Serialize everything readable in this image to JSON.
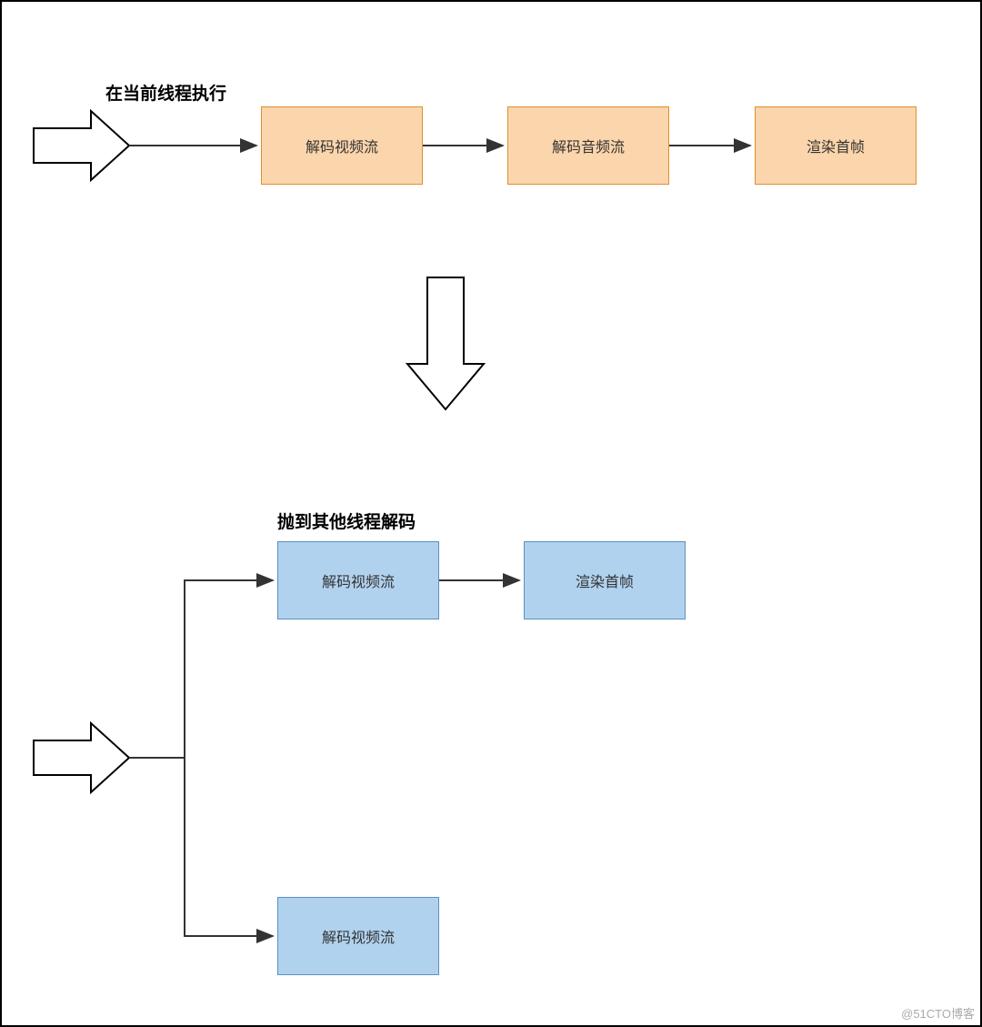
{
  "section1": {
    "title": "在当前线程执行",
    "nodes": {
      "decode_video": "解码视频流",
      "decode_audio": "解码音频流",
      "render_first_frame": "渲染首帧"
    }
  },
  "section2": {
    "title": "抛到其他线程解码",
    "nodes": {
      "decode_video_top": "解码视频流",
      "render_first_frame": "渲染首帧",
      "decode_video_bottom": "解码视频流"
    }
  },
  "watermark": "@51CTO博客"
}
